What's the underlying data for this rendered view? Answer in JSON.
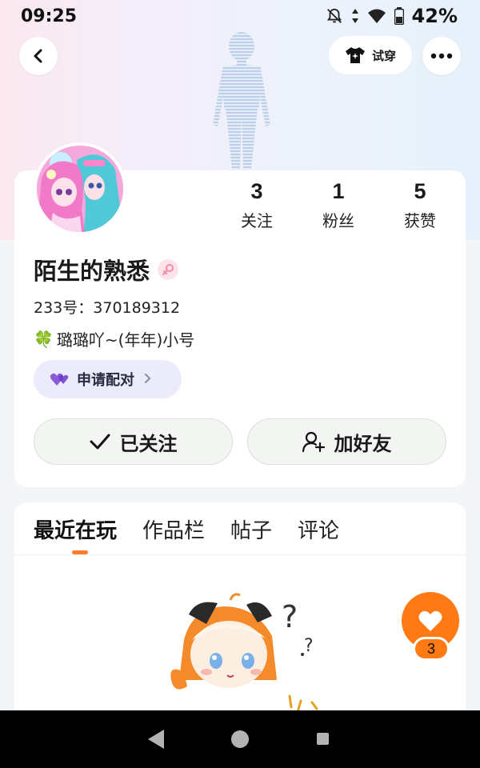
{
  "status_bar": {
    "time": "09:25",
    "battery": "42%"
  },
  "header": {
    "try_on_label": "试穿"
  },
  "stats": [
    {
      "count": "3",
      "label": "关注"
    },
    {
      "count": "1",
      "label": "粉丝"
    },
    {
      "count": "5",
      "label": "获赞"
    }
  ],
  "profile": {
    "nickname": "陌生的熟悉",
    "id_text": "233号：370189312",
    "bio_emoji": "🍀",
    "bio": "璐璐吖~(年年)小号"
  },
  "pair_button": {
    "label": "申请配对"
  },
  "actions": {
    "followed_label": "已关注",
    "add_friend_label": "加好友"
  },
  "tabs": [
    "最近在玩",
    "作品栏",
    "帖子",
    "评论"
  ],
  "like_fab": {
    "count": "3"
  },
  "colors": {
    "accent": "#ff7a14",
    "card_bg": "#ffffff",
    "pair_bg": "#ebebfc"
  }
}
